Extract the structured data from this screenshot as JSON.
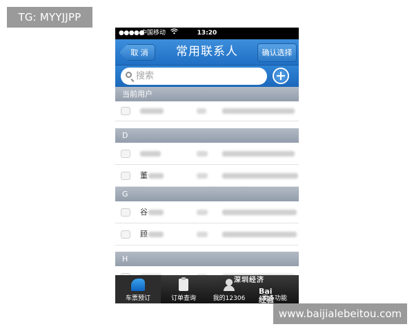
{
  "overlay": {
    "top_left_tag": "TG: MYYJJPP",
    "bottom_right_tag": "www.baijialebeitou.com"
  },
  "status_bar": {
    "signal": "●●●●●",
    "carrier": "中国移动",
    "time": "13:20"
  },
  "nav": {
    "back_label": "取 消",
    "title": "常用联系人",
    "confirm_label": "确认选择"
  },
  "search": {
    "placeholder": "搜索"
  },
  "sections": [
    {
      "header": "当前用户",
      "rows": [
        {
          "name": ""
        }
      ]
    },
    {
      "header": "D",
      "rows": [
        {
          "name": ""
        },
        {
          "name": "董"
        }
      ]
    },
    {
      "header": "G",
      "rows": [
        {
          "name": "谷"
        },
        {
          "name": "顾"
        }
      ]
    },
    {
      "header": "H",
      "rows": [
        {
          "name": ""
        }
      ]
    }
  ],
  "tabbar": {
    "tabs": [
      {
        "label": "车票预订",
        "icon": "train-icon"
      },
      {
        "label": "订单查询",
        "icon": "clipboard-icon"
      },
      {
        "label": "我的12306",
        "icon": "people-icon"
      },
      {
        "label": "更多功能",
        "icon": "more-icon"
      }
    ]
  },
  "watermark": {
    "line1": "深圳经济",
    "line2": "Bai 经验"
  }
}
